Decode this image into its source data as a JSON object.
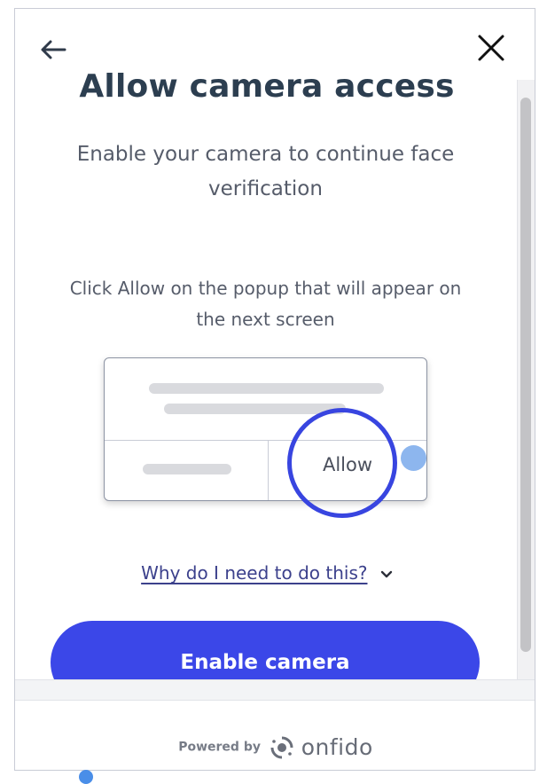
{
  "header": {
    "back_icon": "arrow-left-icon",
    "close_icon": "close-icon"
  },
  "content": {
    "title": "Allow camera access",
    "subtitle": "Enable your camera to continue face verification",
    "instructions": "Click Allow on the popup that will appear on the next screen",
    "popup_allow_label": "Allow",
    "why_link": "Why do I need to do this?",
    "cta_label": "Enable camera"
  },
  "footer": {
    "powered_by": "Powered by",
    "brand": "onfido"
  },
  "colors": {
    "accent": "#3b47e8",
    "title": "#2c3e50",
    "text": "#565c6a",
    "link": "#3c418c",
    "ring": "#3845e0"
  }
}
